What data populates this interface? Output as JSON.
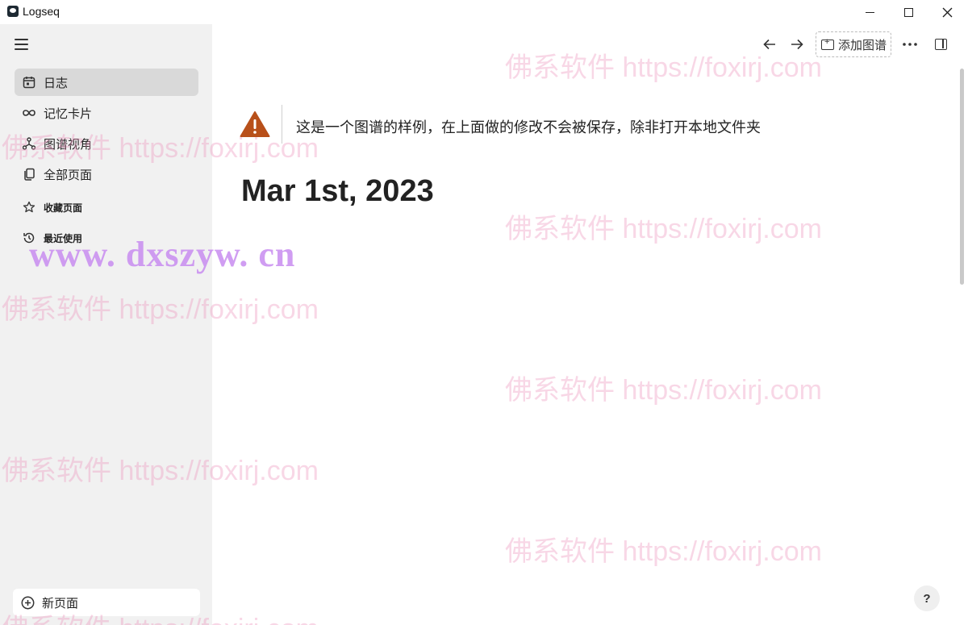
{
  "window": {
    "title": "Logseq",
    "controls": {
      "minimize": "minimize-icon",
      "maximize": "maximize-icon",
      "close": "close-icon"
    }
  },
  "sidebar": {
    "menu_icon": "hamburger-icon",
    "items": [
      {
        "label": "日志",
        "icon": "calendar-icon",
        "active": true
      },
      {
        "label": "记忆卡片",
        "icon": "infinity-icon",
        "active": false
      },
      {
        "label": "图谱视角",
        "icon": "graph-icon",
        "active": false
      },
      {
        "label": "全部页面",
        "icon": "pages-icon",
        "active": false
      },
      {
        "label": "收藏页面",
        "icon": "star-icon",
        "active": false
      },
      {
        "label": "最近使用",
        "icon": "history-icon",
        "active": false
      }
    ],
    "new_page": {
      "label": "新页面",
      "icon": "plus-circle-icon"
    }
  },
  "toolbar": {
    "back_icon": "arrow-left-icon",
    "forward_icon": "arrow-right-icon",
    "add_graph_label": "添加图谱",
    "more_icon": "more-icon",
    "right_sidebar_icon": "panel-icon"
  },
  "main": {
    "notice": "这是一个图谱的样例，在上面做的修改不会被保存，除非打开本地文件夹",
    "journal_title": "Mar 1st, 2023",
    "help_label": "?"
  },
  "watermarks": {
    "pink": "佛系软件 https://foxirj.com",
    "blue": "www. dxszyw. cn"
  },
  "colors": {
    "sidebar_bg": "#f1f1f1",
    "active_item_bg": "#d9d9d9",
    "warning": "#b8501a"
  }
}
